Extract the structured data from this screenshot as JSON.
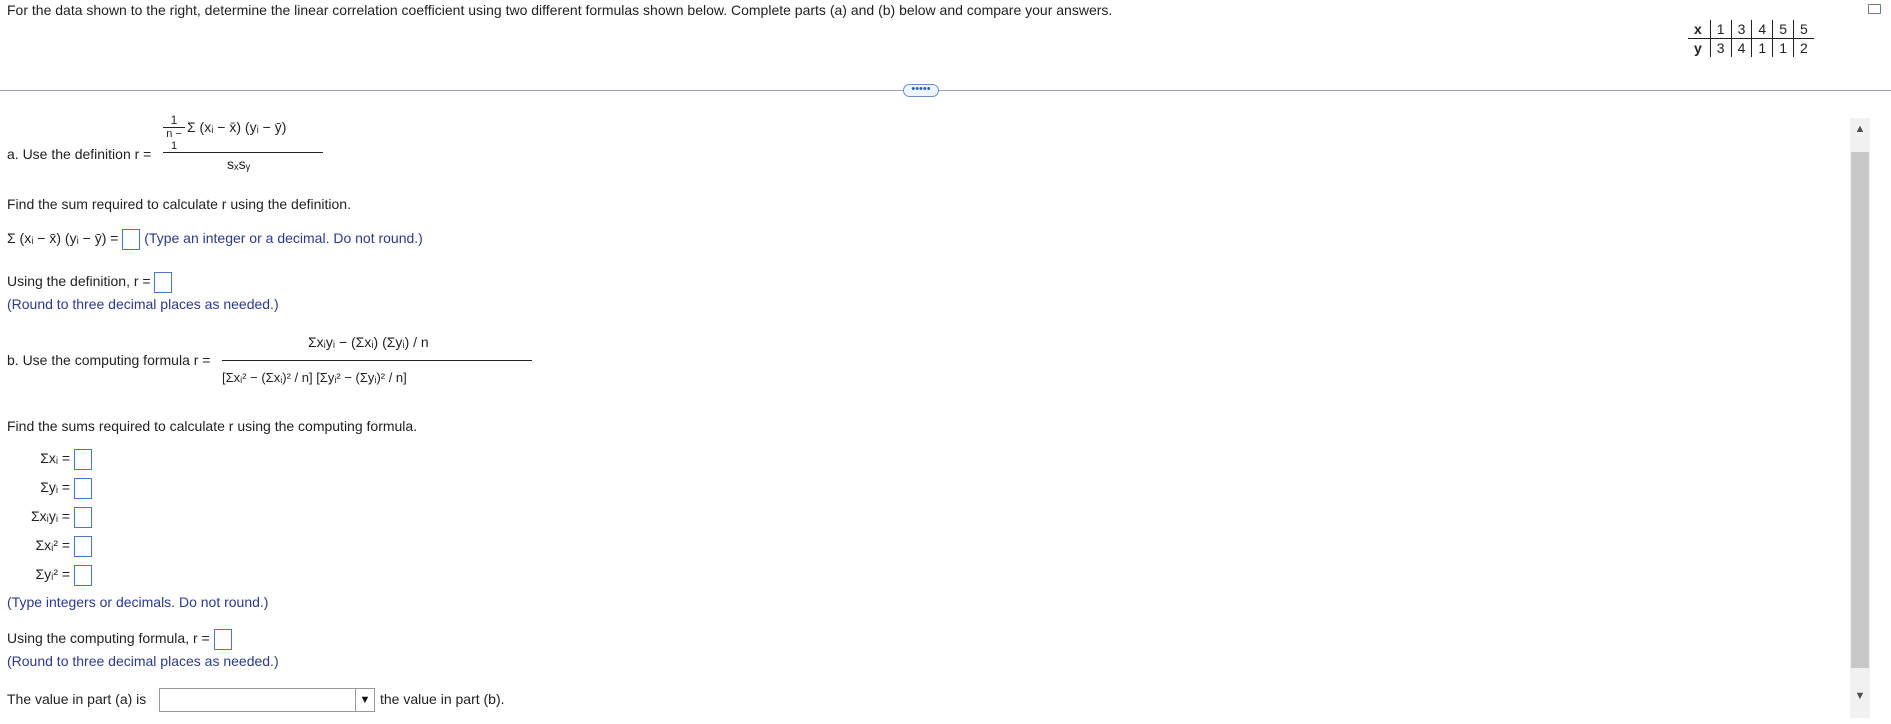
{
  "prompt": "For the data shown to the right, determine the linear correlation coefficient using two different formulas shown below. Complete parts (a) and (b) below and compare your answers.",
  "table": {
    "x_label": "x",
    "y_label": "y",
    "x": [
      "1",
      "3",
      "4",
      "5",
      "5"
    ],
    "y": [
      "3",
      "4",
      "1",
      "1",
      "2"
    ]
  },
  "more_button": "•••••",
  "part_a": {
    "intro": "a. Use the definition r =",
    "formula_numer": "Σ (xᵢ − x̄) (yᵢ − ȳ)",
    "formula_prefactor_top": "1",
    "formula_prefactor_bottom": "n − 1",
    "formula_denom": "sₓsᵧ",
    "find_sum": "Find the sum required to calculate r using the definition.",
    "sum_expr": "Σ (xᵢ − x̄) (yᵢ − ȳ) =",
    "sum_hint": "(Type an integer or a decimal. Do not round.)",
    "r_label": "Using the definition, r =",
    "r_hint": "(Round to three decimal places as needed.)"
  },
  "part_b": {
    "intro": "b. Use the computing formula r =",
    "formula_numer": "Σxᵢyᵢ − (Σxᵢ) (Σyᵢ) / n",
    "formula_denom": "[Σxᵢ² − (Σxᵢ)² / n] [Σyᵢ² − (Σyᵢ)² / n]",
    "find_sums": "Find the sums required to calculate r using the computing formula.",
    "sum_labels": [
      "Σxᵢ =",
      "Σyᵢ =",
      "Σxᵢyᵢ =",
      "Σxᵢ² =",
      "Σyᵢ² ="
    ],
    "sums_hint": "(Type integers or decimals. Do not round.)",
    "r_label": "Using the computing formula, r =",
    "r_hint": "(Round to three decimal places as needed.)"
  },
  "compare": {
    "before": "The value in part (a) is",
    "after": "the value in part (b).",
    "selected": ""
  }
}
